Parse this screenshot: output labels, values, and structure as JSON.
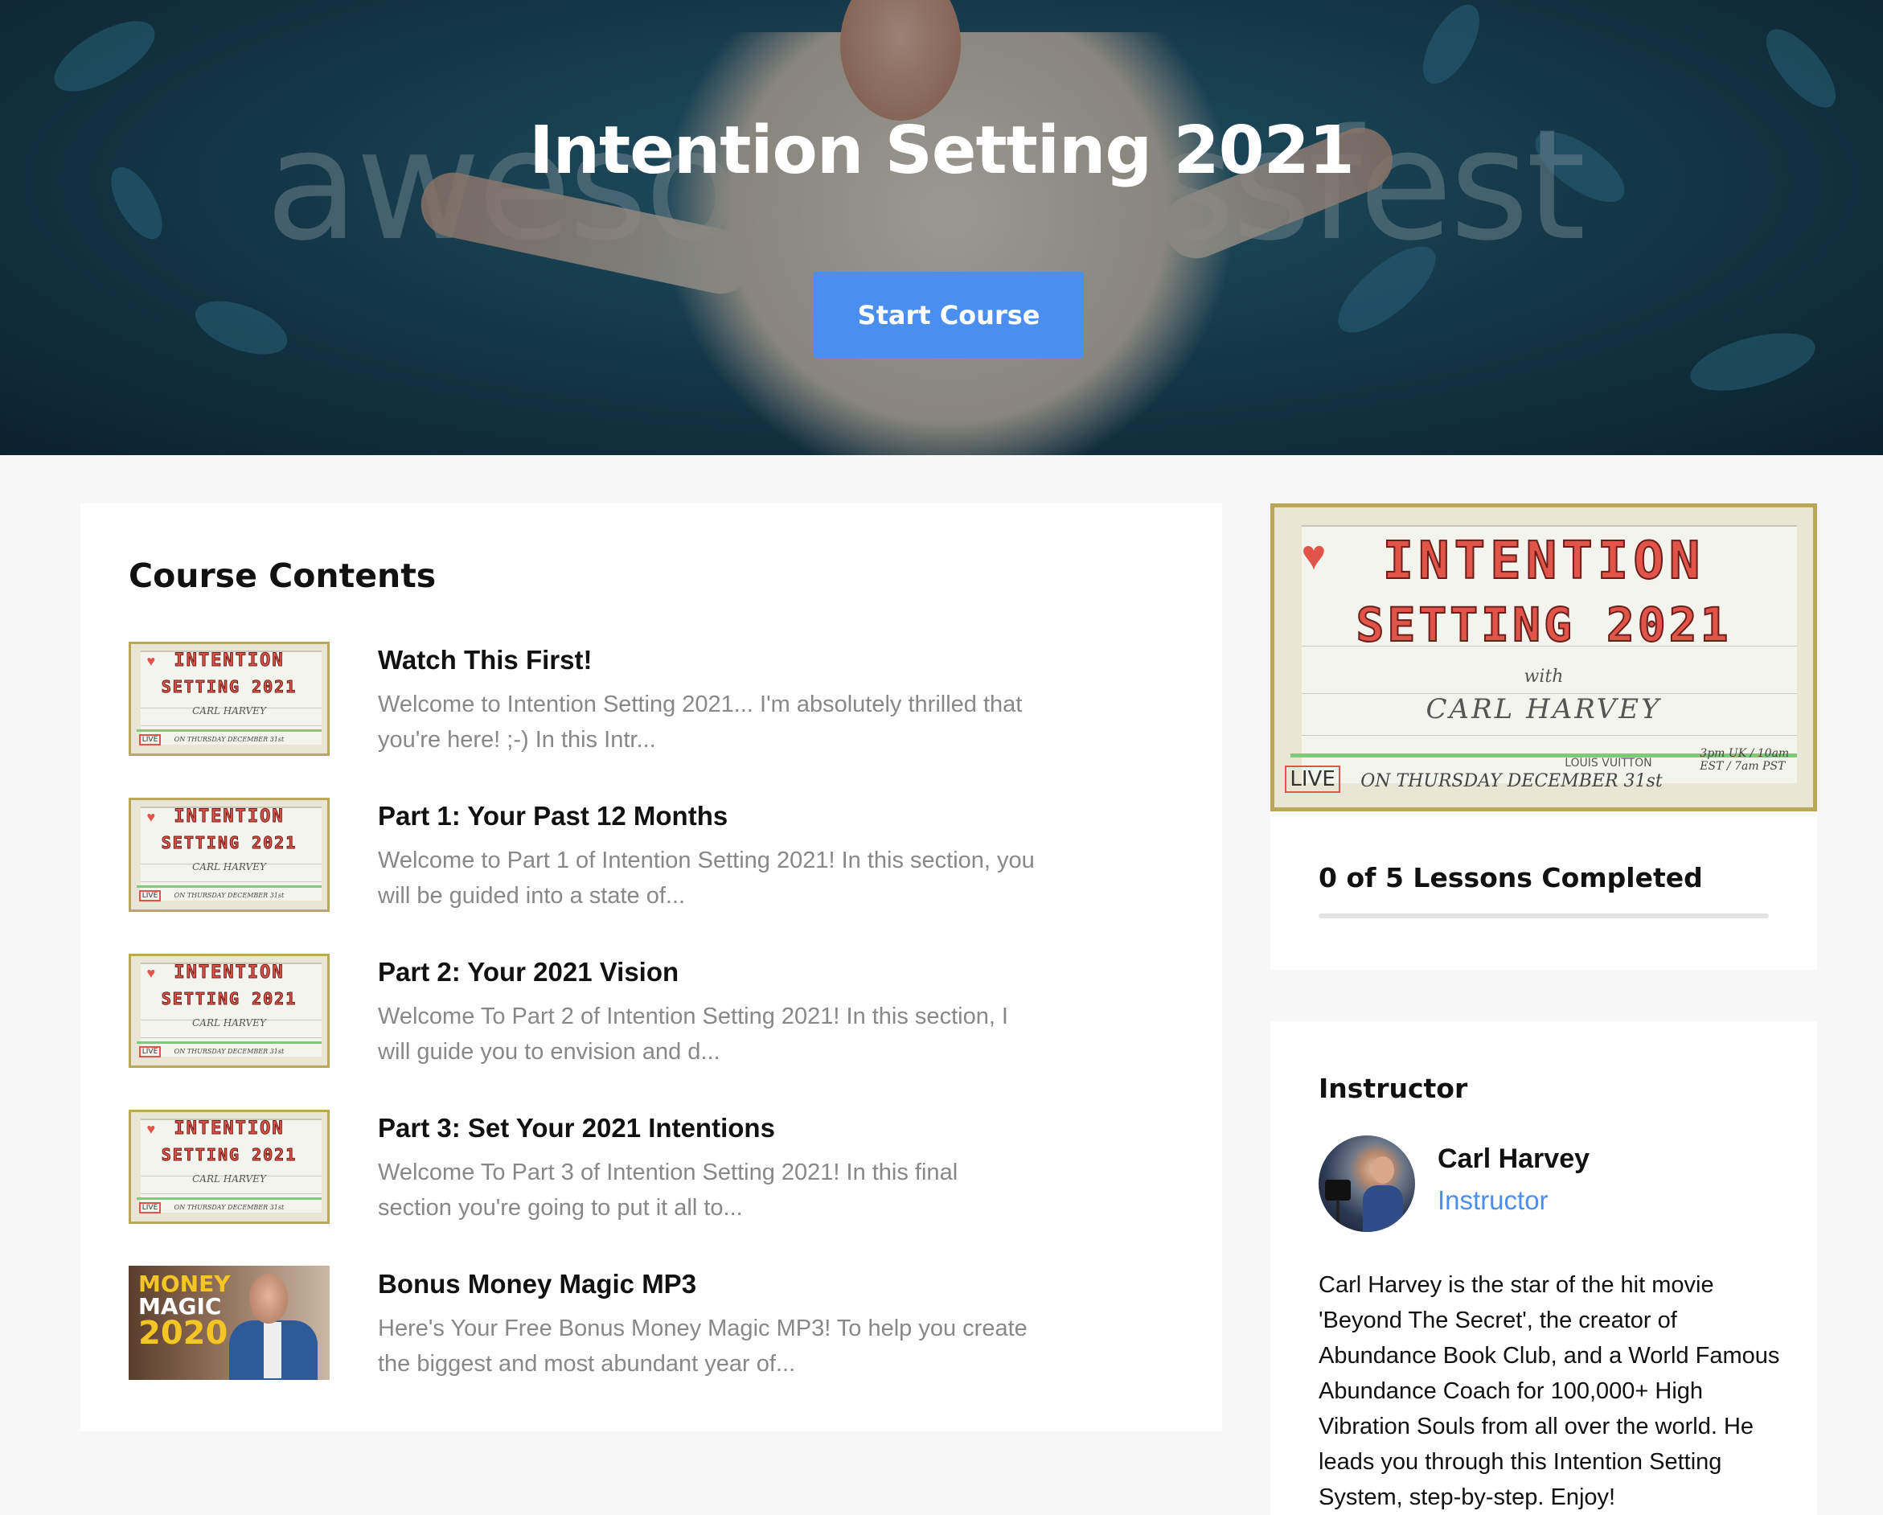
{
  "hero": {
    "title": "Intention Setting 2021",
    "background_text": "awesomenessfest",
    "start_button": "Start Course",
    "accent_color": "#4a8ff0"
  },
  "contents": {
    "title": "Course Contents",
    "lessons": [
      {
        "title": "Watch This First!",
        "description": "Welcome to Intention Setting 2021... I'm absolutely thrilled that you're here! ;-) In this Intr...",
        "thumbnail": "intention-setting-card"
      },
      {
        "title": "Part 1: Your Past 12 Months",
        "description": "Welcome to Part 1 of Intention Setting 2021! In this section, you will be guided into a state of...",
        "thumbnail": "intention-setting-card"
      },
      {
        "title": "Part 2: Your 2021 Vision",
        "description": "Welcome To Part 2 of Intention Setting 2021! In this section, I will guide you to envision and d...",
        "thumbnail": "intention-setting-card"
      },
      {
        "title": "Part 3: Set Your 2021 Intentions",
        "description": "Welcome To Part 3 of Intention Setting 2021! In this final section you're going to put it all to...",
        "thumbnail": "intention-setting-card"
      },
      {
        "title": "Bonus Money Magic MP3",
        "description": "Here's Your Free Bonus Money Magic MP3! To help you create the biggest and most abundant year of...",
        "thumbnail": "money-magic-2020"
      }
    ]
  },
  "card_art": {
    "heart": "♥",
    "line1": "INTENTION",
    "line2": "SETTING 2021",
    "with": "with",
    "name": "CARL HARVEY",
    "brand": "LOUIS VUITTON",
    "live": "LIVE",
    "date": "ON THURSDAY DECEMBER 31st",
    "times": "3pm UK / 10am EST / 7am PST"
  },
  "money_thumb": {
    "line1": "MONEY",
    "line2": "MAGIC",
    "line3": "2020"
  },
  "progress": {
    "label": "0 of 5 Lessons Completed",
    "completed": 0,
    "total": 5
  },
  "instructor": {
    "section_title": "Instructor",
    "name": "Carl Harvey",
    "role": "Instructor",
    "bio": "Carl Harvey is the star of the hit movie 'Beyond The Secret', the creator of Abundance Book Club, and a World Famous Abundance Coach for 100,000+ High Vibration Souls from all over the world. He leads you through this Intention Setting System, step-by-step. Enjoy!"
  }
}
